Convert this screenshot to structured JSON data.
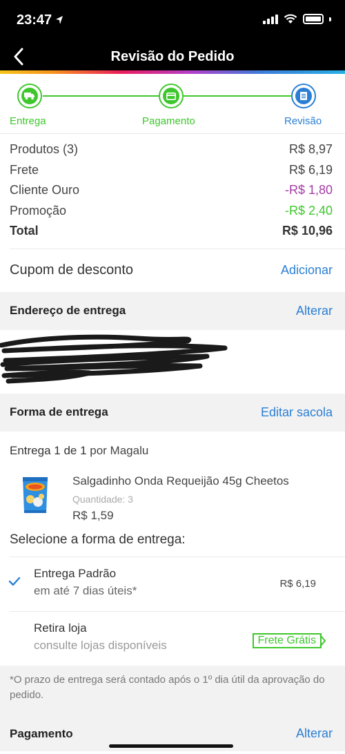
{
  "status_bar": {
    "time": "23:47"
  },
  "header": {
    "title": "Revisão do Pedido"
  },
  "stepper": {
    "steps": [
      {
        "label": "Entrega",
        "color": "#3ec72c"
      },
      {
        "label": "Pagamento",
        "color": "#3ec72c"
      },
      {
        "label": "Revisão",
        "color": "#2a7fd4"
      }
    ]
  },
  "summary": {
    "rows": [
      {
        "label": "Produtos (3)",
        "value": "R$ 8,97"
      },
      {
        "label": "Frete",
        "value": "R$ 6,19"
      },
      {
        "label": "Cliente Ouro",
        "value": "-R$ 1,80",
        "color": "#a63aa6"
      },
      {
        "label": "Promoção",
        "value": "-R$ 2,40",
        "color": "#3ec72c"
      }
    ],
    "total": {
      "label": "Total",
      "value": "R$ 10,96"
    }
  },
  "coupon": {
    "label": "Cupom de desconto",
    "action": "Adicionar"
  },
  "address_section": {
    "title": "Endereço de entrega",
    "action": "Alterar"
  },
  "delivery_section": {
    "title": "Forma de entrega",
    "action": "Editar sacola"
  },
  "delivery_info": {
    "prefix": "Entrega 1 de 1",
    "seller": " por Magalu"
  },
  "product": {
    "name": "Salgadinho Onda Requeijão 45g Cheetos",
    "quantity": "Quantidade: 3",
    "price": "R$ 1,59"
  },
  "shipping": {
    "title": "Selecione a forma de entrega:",
    "options": [
      {
        "name": "Entrega Padrão",
        "sub": "em até 7 dias úteis*",
        "price": "R$ 6,19",
        "selected": true
      },
      {
        "name": "Retira loja",
        "sub": "consulte lojas disponíveis",
        "badge": "Frete Grátis",
        "selected": false
      }
    ]
  },
  "note": "*O prazo de entrega será contado após o 1º dia útil da aprovação do pedido.",
  "payment_section": {
    "title": "Pagamento",
    "action": "Alterar"
  },
  "colors": {
    "accent": "#2a7fd4",
    "success": "#3ec72c",
    "gold": "#a63aa6"
  }
}
